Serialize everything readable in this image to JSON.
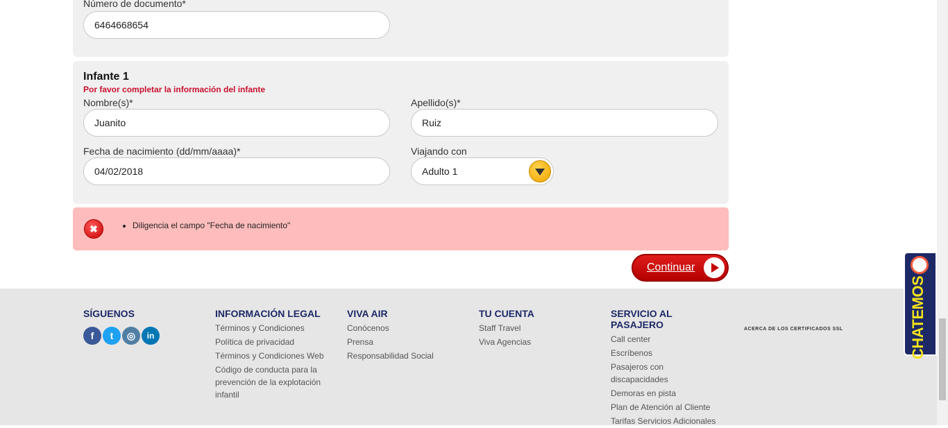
{
  "form": {
    "document_label": "Número de documento*",
    "document_value": "6464668654",
    "infant": {
      "title": "Infante 1",
      "warning": "Por favor completar la información del infante",
      "first_name_label": "Nombre(s)*",
      "first_name_value": "Juanito",
      "last_name_label": "Apellido(s)*",
      "last_name_value": "Ruiz",
      "birthdate_label": "Fecha de nacimiento (dd/mm/aaaa)*",
      "birthdate_value": "04/02/2018",
      "travelling_with_label": "Viajando con",
      "travelling_with_value": "Adulto 1"
    }
  },
  "error": {
    "icon": "close-icon",
    "messages": [
      "Diligencia el campo \"Fecha de nacimiento\""
    ]
  },
  "continue_button": {
    "label": "Continuar",
    "icon": "play-arrow-icon"
  },
  "footer": {
    "social": {
      "heading": "SÍGUENOS",
      "icons": [
        {
          "name": "facebook-icon",
          "glyph": "f",
          "color": "#3b5998"
        },
        {
          "name": "twitter-icon",
          "glyph": "t",
          "color": "#1da1f2"
        },
        {
          "name": "instagram-icon",
          "glyph": "◎",
          "color": "#517fa4"
        },
        {
          "name": "linkedin-icon",
          "glyph": "in",
          "color": "#0077b5"
        }
      ]
    },
    "legal": {
      "heading": "INFORMACIÓN LEGAL",
      "links": [
        "Términos y Condiciones",
        "Política de privacidad",
        "Términos y Condiciones Web",
        "Código de conducta para la prevención de la explotación infantil"
      ]
    },
    "viva_air": {
      "heading": "VIVA AIR",
      "links": [
        "Conócenos",
        "Prensa",
        "Responsabilidad Social"
      ]
    },
    "account": {
      "heading": "TU CUENTA",
      "links": [
        "Staff Travel",
        "Viva Agencias"
      ]
    },
    "service": {
      "heading": "SERVICIO AL PASAJERO",
      "links": [
        "Call center",
        "Escríbenos",
        "Pasajeros con discapacidades",
        "Demoras en pista",
        "Plan de Atención al Cliente",
        "Tarifas Servicios Adicionales"
      ]
    },
    "ssl_text": "ACERCA DE LOS CERTIFICADOS SSL"
  },
  "chat_widget": {
    "label": "CHATEMOS",
    "icon": "chat-bubble-icon"
  },
  "colors": {
    "accent_red": "#c40000",
    "footer_heading": "#1d2866",
    "error_bg": "#ffbcbc",
    "select_arrow": "#f0a500",
    "chat_text": "#f0e21c"
  }
}
